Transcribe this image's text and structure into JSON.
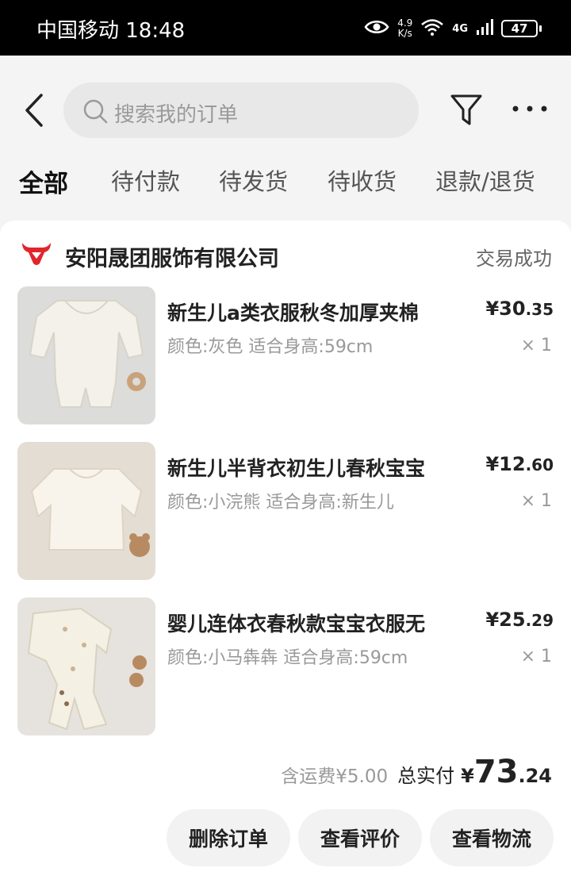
{
  "status_bar": {
    "carrier_time": "中国移动 18:48",
    "net_speed_value": "4.9",
    "net_speed_unit": "K/s",
    "network": "4G",
    "battery": "47"
  },
  "header": {
    "search_placeholder": "搜索我的订单",
    "tabs": [
      {
        "label": "全部",
        "active": true
      },
      {
        "label": "待付款",
        "active": false
      },
      {
        "label": "待发货",
        "active": false
      },
      {
        "label": "待收货",
        "active": false
      },
      {
        "label": "退款/退货",
        "active": false
      }
    ]
  },
  "order": {
    "shop_name": "安阳晟团服饰有限公司",
    "status": "交易成功",
    "items": [
      {
        "title": "新生儿a类衣服秋冬加厚夹棉",
        "spec": "颜色:灰色 适合身高:59cm",
        "price_int": "¥30",
        "price_dec": ".35",
        "qty": "× 1"
      },
      {
        "title": "新生儿半背衣初生儿春秋宝宝",
        "spec": "颜色:小浣熊 适合身高:新生儿",
        "price_int": "¥12",
        "price_dec": ".60",
        "qty": "× 1"
      },
      {
        "title": "婴儿连体衣春秋款宝宝衣服无",
        "spec": "颜色:小马犇犇 适合身高:59cm",
        "price_int": "¥25",
        "price_dec": ".29",
        "qty": "× 1"
      }
    ],
    "shipping": "含运费¥5.00",
    "total_label": "总实付",
    "total_currency": "¥",
    "total_int": "73",
    "total_dec": ".24"
  },
  "actions": {
    "delete": "删除订单",
    "review": "查看评价",
    "logistics": "查看物流"
  },
  "colors": {
    "background": "#f4f4f4",
    "card": "#ffffff",
    "logo_red": "#e0262c",
    "muted_text": "#999999"
  }
}
